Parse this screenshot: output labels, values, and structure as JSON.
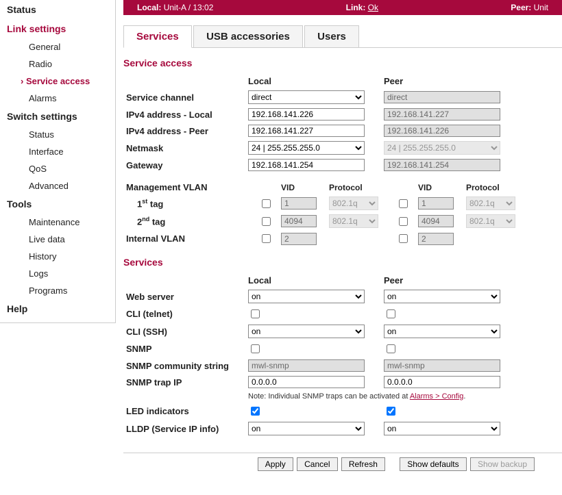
{
  "topbar": {
    "local_lbl": "Local:",
    "local_val": "Unit-A / 13:02",
    "link_lbl": "Link:",
    "link_val": "Ok",
    "peer_lbl": "Peer:",
    "peer_val": "Unit"
  },
  "sidebar": {
    "status": "Status",
    "link": "Link settings",
    "link_items": [
      "General",
      "Radio",
      "Service access",
      "Alarms"
    ],
    "switch": "Switch settings",
    "switch_items": [
      "Status",
      "Interface",
      "QoS",
      "Advanced"
    ],
    "tools": "Tools",
    "tools_items": [
      "Maintenance",
      "Live data",
      "History",
      "Logs",
      "Programs"
    ],
    "help": "Help"
  },
  "tabs": [
    "Services",
    "USB accessories",
    "Users"
  ],
  "sa": {
    "heading": "Service access",
    "col_local": "Local",
    "col_peer": "Peer",
    "rows": {
      "chan": "Service channel",
      "chan_local": "direct",
      "chan_peer": "direct",
      "ip_l": "IPv4 address - Local",
      "ip_l_local": "192.168.141.226",
      "ip_l_peer": "192.168.141.227",
      "ip_p": "IPv4 address - Peer",
      "ip_p_local": "192.168.141.227",
      "ip_p_peer": "192.168.141.226",
      "mask": "Netmask",
      "mask_l": "24  |  255.255.255.0",
      "mask_p": "24  |  255.255.255.0",
      "gw": "Gateway",
      "gw_l": "192.168.141.254",
      "gw_p": "192.168.141.254"
    },
    "vlan": {
      "heading": "Management VLAN",
      "vid": "VID",
      "proto": "Protocol",
      "tag1": "1st tag",
      "tag2": "2nd tag",
      "internal": "Internal VLAN",
      "t1_vid": "1",
      "t1_proto": "802.1q",
      "t1_vid_p": "1",
      "t1_proto_p": "802.1q",
      "t2_vid": "4094",
      "t2_proto": "802.1q",
      "t2_vid_p": "4094",
      "t2_proto_p": "802.1q",
      "int_vid": "2",
      "int_vid_p": "2"
    }
  },
  "sv": {
    "heading": "Services",
    "col_local": "Local",
    "col_peer": "Peer",
    "rows": {
      "web": "Web server",
      "web_l": "on",
      "web_p": "on",
      "telnet": "CLI (telnet)",
      "ssh": "CLI (SSH)",
      "ssh_l": "on",
      "ssh_p": "on",
      "snmp": "SNMP",
      "snmpstr": "SNMP community string",
      "snmpstr_l": "mwl-snmp",
      "snmpstr_p": "mwl-snmp",
      "trap": "SNMP trap IP",
      "trap_l": "0.0.0.0",
      "trap_p": "0.0.0.0",
      "note": "Note: Individual SNMP traps can be activated at ",
      "note_link": "Alarms > Config",
      "led": "LED indicators",
      "lldp": "LLDP (Service IP info)",
      "lldp_l": "on",
      "lldp_p": "on"
    }
  },
  "buttons": {
    "apply": "Apply",
    "cancel": "Cancel",
    "refresh": "Refresh",
    "defaults": "Show defaults",
    "backup": "Show backup"
  }
}
